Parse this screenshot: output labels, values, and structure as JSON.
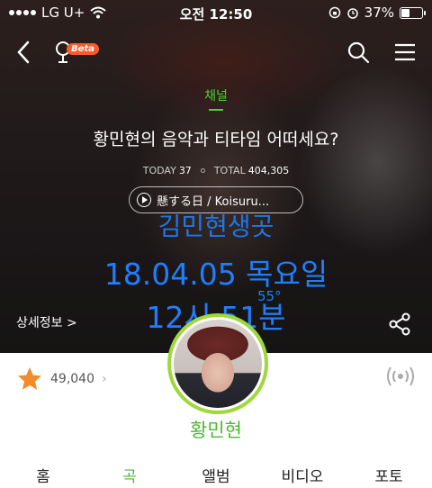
{
  "status_bar": {
    "carrier": "LG U+",
    "time": "오전 12:50",
    "battery_text": "37%",
    "battery_level": 0.37
  },
  "nav": {
    "back_icon": "chevron-left-icon",
    "mic_icon": "mic-icon",
    "beta_badge": "Beta",
    "search_icon": "search-icon",
    "menu_icon": "hamburger-menu-icon"
  },
  "channel": {
    "label": "채널",
    "title": "황민현의 음악과 티타임 어떠세요?",
    "today_label": "TODAY",
    "today_value": "37",
    "total_label": "TOTAL",
    "total_value": "404,305",
    "now_playing": "懸する日 / Koisuru..."
  },
  "overlay": {
    "line1": "김민현생곳",
    "line2": "18.04.05 목요일",
    "line3": "12시 51분",
    "temperature": "55°"
  },
  "detail_link": "상세정보 >",
  "rating": {
    "value": "49,040",
    "chevron": "›"
  },
  "artist_name": "황민현",
  "tabs": [
    "홈",
    "곡",
    "앨범",
    "비디오",
    "포토"
  ],
  "active_tab": "곡",
  "colors": {
    "accent_green": "#4cb830",
    "overlay_blue": "#1e7fff",
    "star_orange": "#f28c2a",
    "avatar_ring": "#9ed83a",
    "beta_orange": "#ff5a2a"
  }
}
